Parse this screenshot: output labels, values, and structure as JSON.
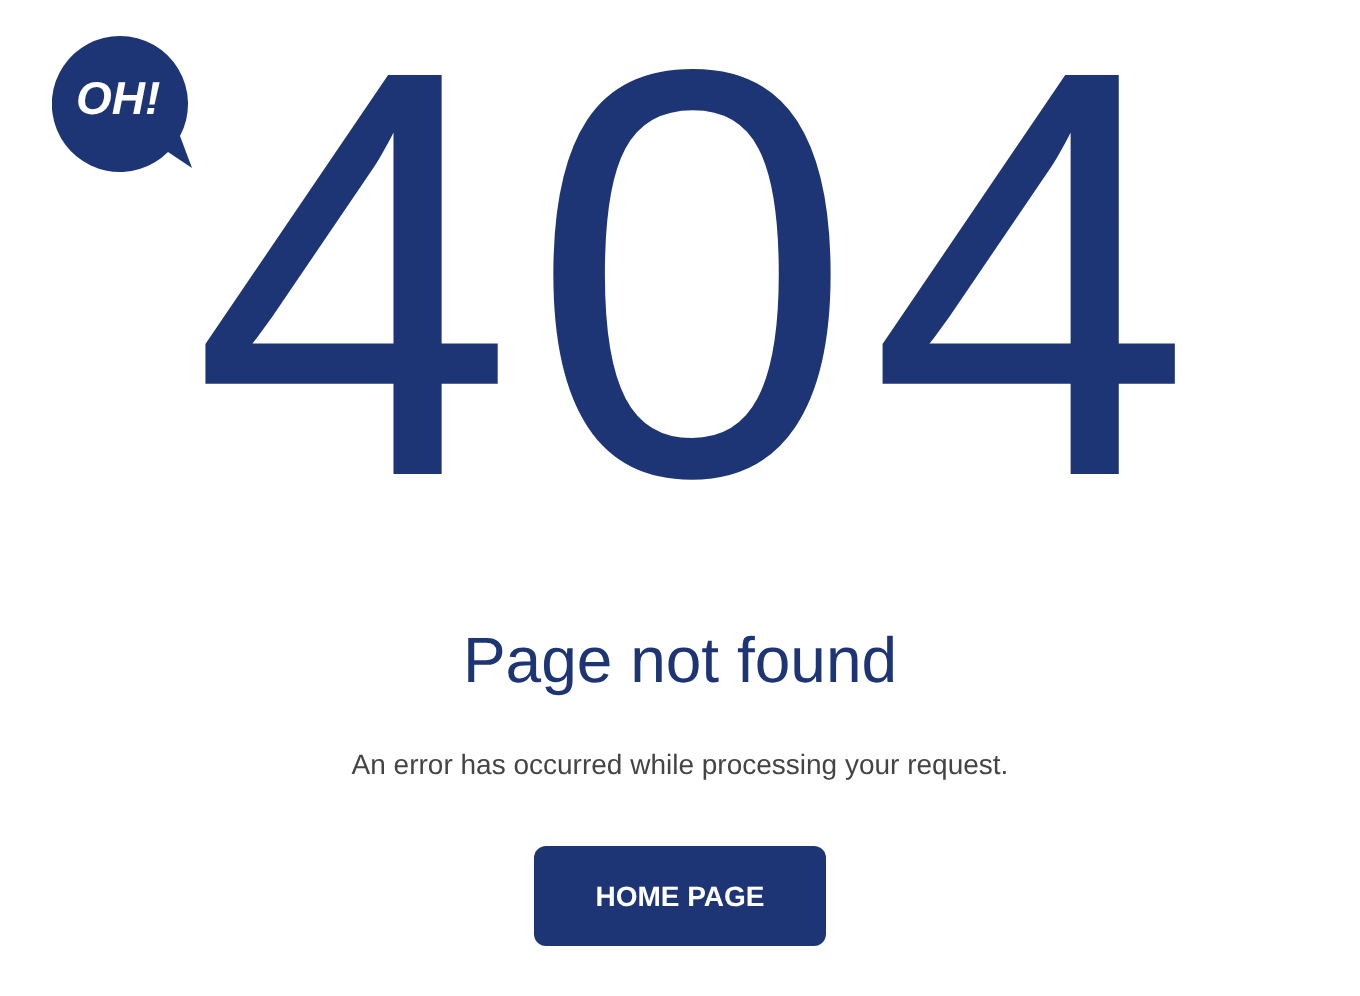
{
  "badge": {
    "text": "OH!"
  },
  "code": "404",
  "title": "Page not found",
  "message": "An error has occurred while processing your request.",
  "button": {
    "label": "HOME PAGE"
  }
}
